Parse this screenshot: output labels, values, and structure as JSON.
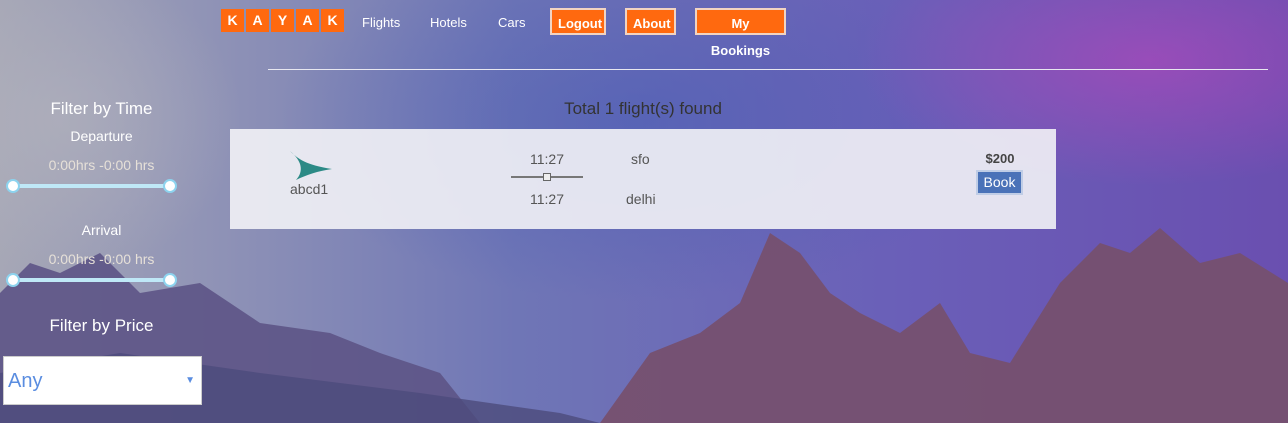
{
  "nav": {
    "logo_letters": [
      "K",
      "A",
      "Y",
      "A",
      "K"
    ],
    "links": [
      "Flights",
      "Hotels",
      "Cars"
    ],
    "buttons": [
      "Logout",
      "About",
      "My Bookings"
    ],
    "accent_color": "#ff690f"
  },
  "sidebar": {
    "time_title": "Filter by Time",
    "departure_label": "Departure",
    "departure_range": "0:00hrs -0:00 hrs",
    "arrival_label": "Arrival",
    "arrival_range": "0:00hrs -0:00 hrs",
    "price_title": "Filter by Price",
    "price_selected": "Any"
  },
  "results": {
    "summary": "Total 1 flight(s) found",
    "flights": [
      {
        "airline": "abcd1",
        "logo_icon": "airline-swoosh-icon",
        "depart_time": "11:27",
        "arrive_time": "11:27",
        "from": "sfo",
        "to": "delhi",
        "price": "$200",
        "book_label": "Book"
      }
    ]
  }
}
